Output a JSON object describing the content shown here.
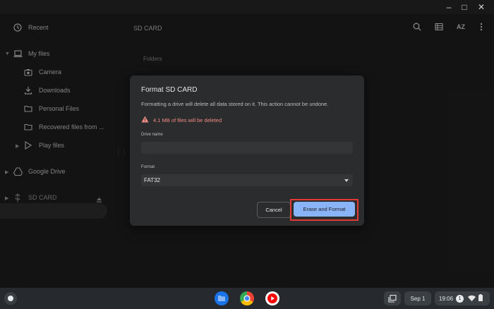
{
  "window": {
    "minimize": "–",
    "maximize": "□",
    "close": "✕"
  },
  "sidebar": {
    "recent": "Recent",
    "my_files": "My files",
    "camera": "Camera",
    "downloads": "Downloads",
    "personal_files": "Personal Files",
    "recovered_files": "Recovered files from ...",
    "play_files": "Play files",
    "google_drive": "Google Drive",
    "sd_card": "SD CARD"
  },
  "main": {
    "breadcrumb": "SD CARD",
    "folders_label": "Folders",
    "sort_label": "AZ"
  },
  "dialog": {
    "title": "Format SD CARD",
    "description": "Formatting a drive will delete all data stored on it. This action cannot be undone.",
    "warning": "4.1 MB of files will be deleted",
    "drive_name_label": "Drive name",
    "drive_name_value": "",
    "format_label": "Format",
    "format_value": "FAT32",
    "cancel_label": "Cancel",
    "erase_label": "Erase and Format"
  },
  "shelf": {
    "date": "Sep 1",
    "time": "19:06",
    "notification_count": "1"
  },
  "colors": {
    "accent": "#8ab4f8",
    "highlight": "#e53935",
    "warning": "#f28b82"
  }
}
